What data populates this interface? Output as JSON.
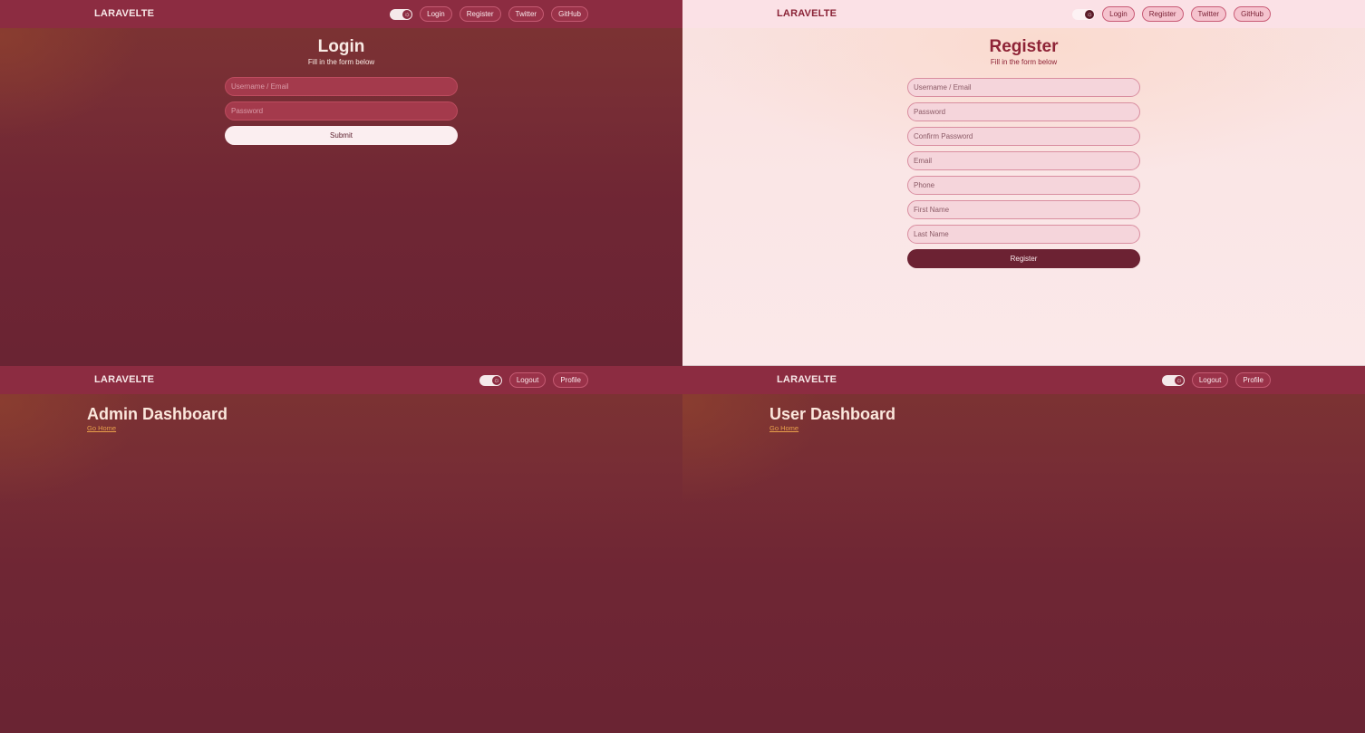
{
  "brand": "LARAVELTE",
  "colors": {
    "nav_dark": "#8c2c41",
    "nav_light": "#fbe1e6",
    "page_dark": "#6e2533",
    "page_light": "#fae6e6",
    "title_light": "#8e2336",
    "link_accent": "#e8a04b"
  },
  "guest_nav": {
    "theme_toggle_icon": "sun-icon",
    "login": "Login",
    "register": "Register",
    "twitter": "Twitter",
    "github": "GitHub"
  },
  "auth_nav": {
    "theme_toggle_icon": "sun-icon",
    "logout": "Logout",
    "profile": "Profile"
  },
  "login": {
    "title": "Login",
    "subtitle": "Fill in the form below",
    "fields": {
      "username_placeholder": "Username / Email",
      "password_placeholder": "Password"
    },
    "submit_label": "Submit"
  },
  "register": {
    "title": "Register",
    "subtitle": "Fill in the form below",
    "fields": {
      "username_placeholder": "Username / Email",
      "password_placeholder": "Password",
      "confirm_password_placeholder": "Confirm Password",
      "email_placeholder": "Email",
      "phone_placeholder": "Phone",
      "first_name_placeholder": "First Name",
      "last_name_placeholder": "Last Name"
    },
    "submit_label": "Register"
  },
  "admin_dashboard": {
    "title": "Admin Dashboard",
    "link": "Go Home"
  },
  "user_dashboard": {
    "title": "User Dashboard",
    "link": "Go Home"
  }
}
